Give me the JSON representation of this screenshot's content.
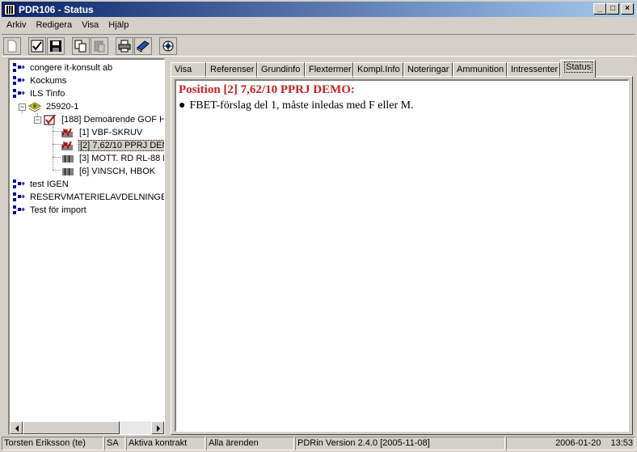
{
  "window": {
    "title": "PDR106 - Status"
  },
  "menu": [
    "Arkiv",
    "Redigera",
    "Visa",
    "Hjälp"
  ],
  "tree": {
    "items": [
      {
        "label": "congere it-konsult ab",
        "level": 0,
        "icon": "company-icon"
      },
      {
        "label": "Kockums",
        "level": 0,
        "icon": "company-icon"
      },
      {
        "label": "ILS Tinfo",
        "level": 0,
        "icon": "company-icon"
      },
      {
        "label": "25920-1",
        "level": 1,
        "icon": "contract-icon",
        "expanded": true
      },
      {
        "label": "[188] Demoärende GOF H",
        "level": 2,
        "icon": "case-icon",
        "expanded": true
      },
      {
        "label": "[1] VBF-SKRUV",
        "level": 3,
        "icon": "position-red-icon"
      },
      {
        "label": "[2] 7,62/10 PPRJ DEM",
        "level": 3,
        "icon": "position-red-icon",
        "selected": true
      },
      {
        "label": "[3] MOTT. RD RL-88 D",
        "level": 3,
        "icon": "barcode-icon"
      },
      {
        "label": "[6] VINSCH, HBOK",
        "level": 3,
        "icon": "barcode-icon"
      },
      {
        "label": "test IGEN",
        "level": 0,
        "icon": "company-icon"
      },
      {
        "label": "RESERVMATERIELAVDELNINGE",
        "level": 0,
        "icon": "company-icon"
      },
      {
        "label": "Test för import",
        "level": 0,
        "icon": "company-icon"
      }
    ]
  },
  "tabs": [
    "Visa",
    "Referenser",
    "Grundinfo",
    "Flextermer",
    "Kompl.Info",
    "Noteringar",
    "Ammunition",
    "Intressenter",
    "Status"
  ],
  "active_tab": "Status",
  "content": {
    "title": "Position [2] 7,62/10 PPRJ DEMO:",
    "bullet": "FBET-förslag del 1, måste inledas med F eller M."
  },
  "status_bar": {
    "user": "Torsten Eriksson (te)",
    "code": "SA",
    "contracts": "Aktiva kontrakt",
    "cases": "Alla ärenden",
    "version": "PDRin Version 2.4.0 [2005-11-08]",
    "date": "2006-01-20",
    "time": "13:53"
  },
  "colors": {
    "title_gradient_start": "#0a246a",
    "content_title": "#cc2020",
    "chrome": "#d4d0c8"
  }
}
